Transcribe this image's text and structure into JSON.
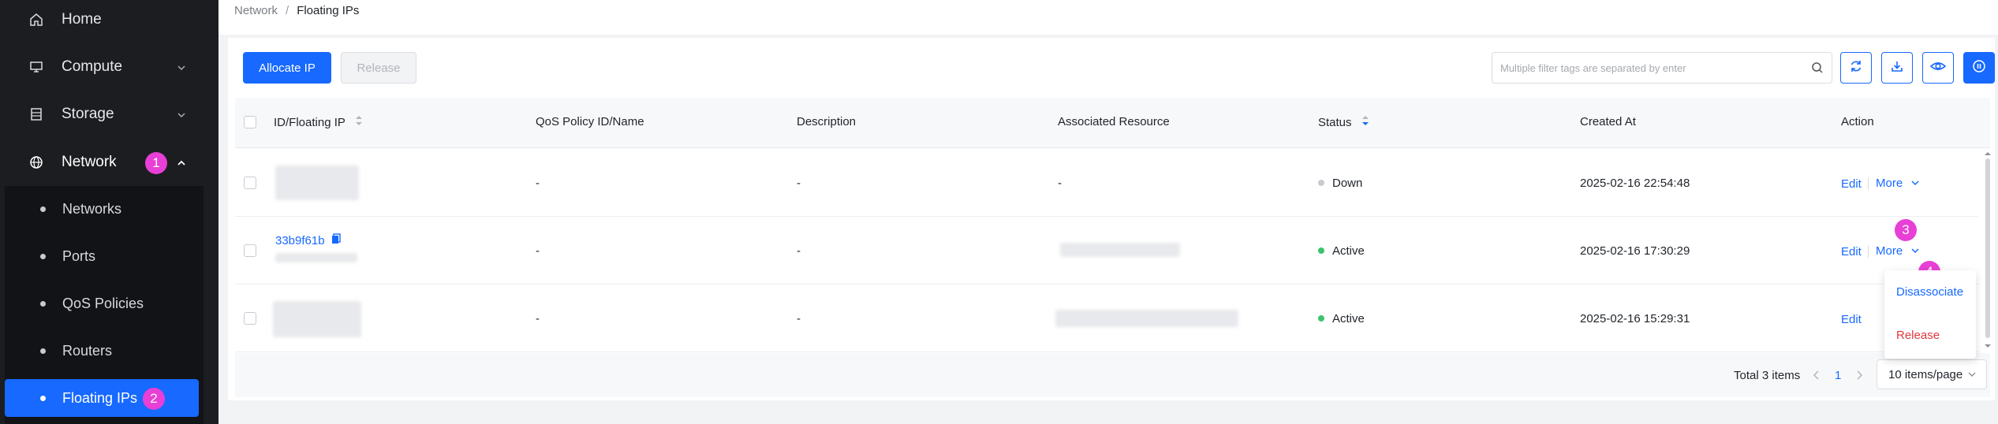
{
  "sidebar": {
    "items": [
      {
        "label": "Home",
        "icon": "home-icon"
      },
      {
        "label": "Compute",
        "icon": "monitor-icon"
      },
      {
        "label": "Storage",
        "icon": "storage-icon"
      },
      {
        "label": "Network",
        "icon": "globe-icon"
      }
    ],
    "network_badge": "1",
    "sub_items": [
      {
        "label": "Networks"
      },
      {
        "label": "Ports"
      },
      {
        "label": "QoS Policies"
      },
      {
        "label": "Routers"
      },
      {
        "label": "Floating IPs"
      }
    ],
    "floating_badge": "2"
  },
  "breadcrumb": {
    "parent": "Network",
    "separator": "/",
    "current": "Floating IPs"
  },
  "toolbar": {
    "allocate_label": "Allocate IP",
    "release_label": "Release",
    "search_placeholder": "Multiple filter tags are separated by enter"
  },
  "table": {
    "headers": {
      "id": "ID/Floating IP",
      "qos": "QoS Policy ID/Name",
      "description": "Description",
      "resource": "Associated Resource",
      "status": "Status",
      "created": "Created At",
      "action": "Action"
    },
    "rows": [
      {
        "id": "",
        "qos": "-",
        "description": "-",
        "resource": "-",
        "status": "Down",
        "status_color": "#c9cbd1",
        "created": "2025-02-16 22:54:48",
        "edit": "Edit",
        "more": "More"
      },
      {
        "id": "33b9f61b",
        "qos": "-",
        "description": "-",
        "resource": "",
        "status": "Active",
        "status_color": "#3cc46b",
        "created": "2025-02-16 17:30:29",
        "edit": "Edit",
        "more": "More"
      },
      {
        "id": "",
        "qos": "-",
        "description": "-",
        "resource": "",
        "status": "Active",
        "status_color": "#3cc46b",
        "created": "2025-02-16 15:29:31",
        "edit": "Edit",
        "more": ""
      }
    ]
  },
  "annotations": {
    "more_badge": "3",
    "menu_badge": "4"
  },
  "dropdown": {
    "disassociate": "Disassociate",
    "release": "Release"
  },
  "pagination": {
    "total": "Total 3 items",
    "page": "1",
    "page_size": "10 items/page"
  },
  "colors": {
    "accent": "#1769ff",
    "danger": "#e0383e",
    "badge": "#e83fd6",
    "sidebar_bg": "#1c1d21"
  }
}
